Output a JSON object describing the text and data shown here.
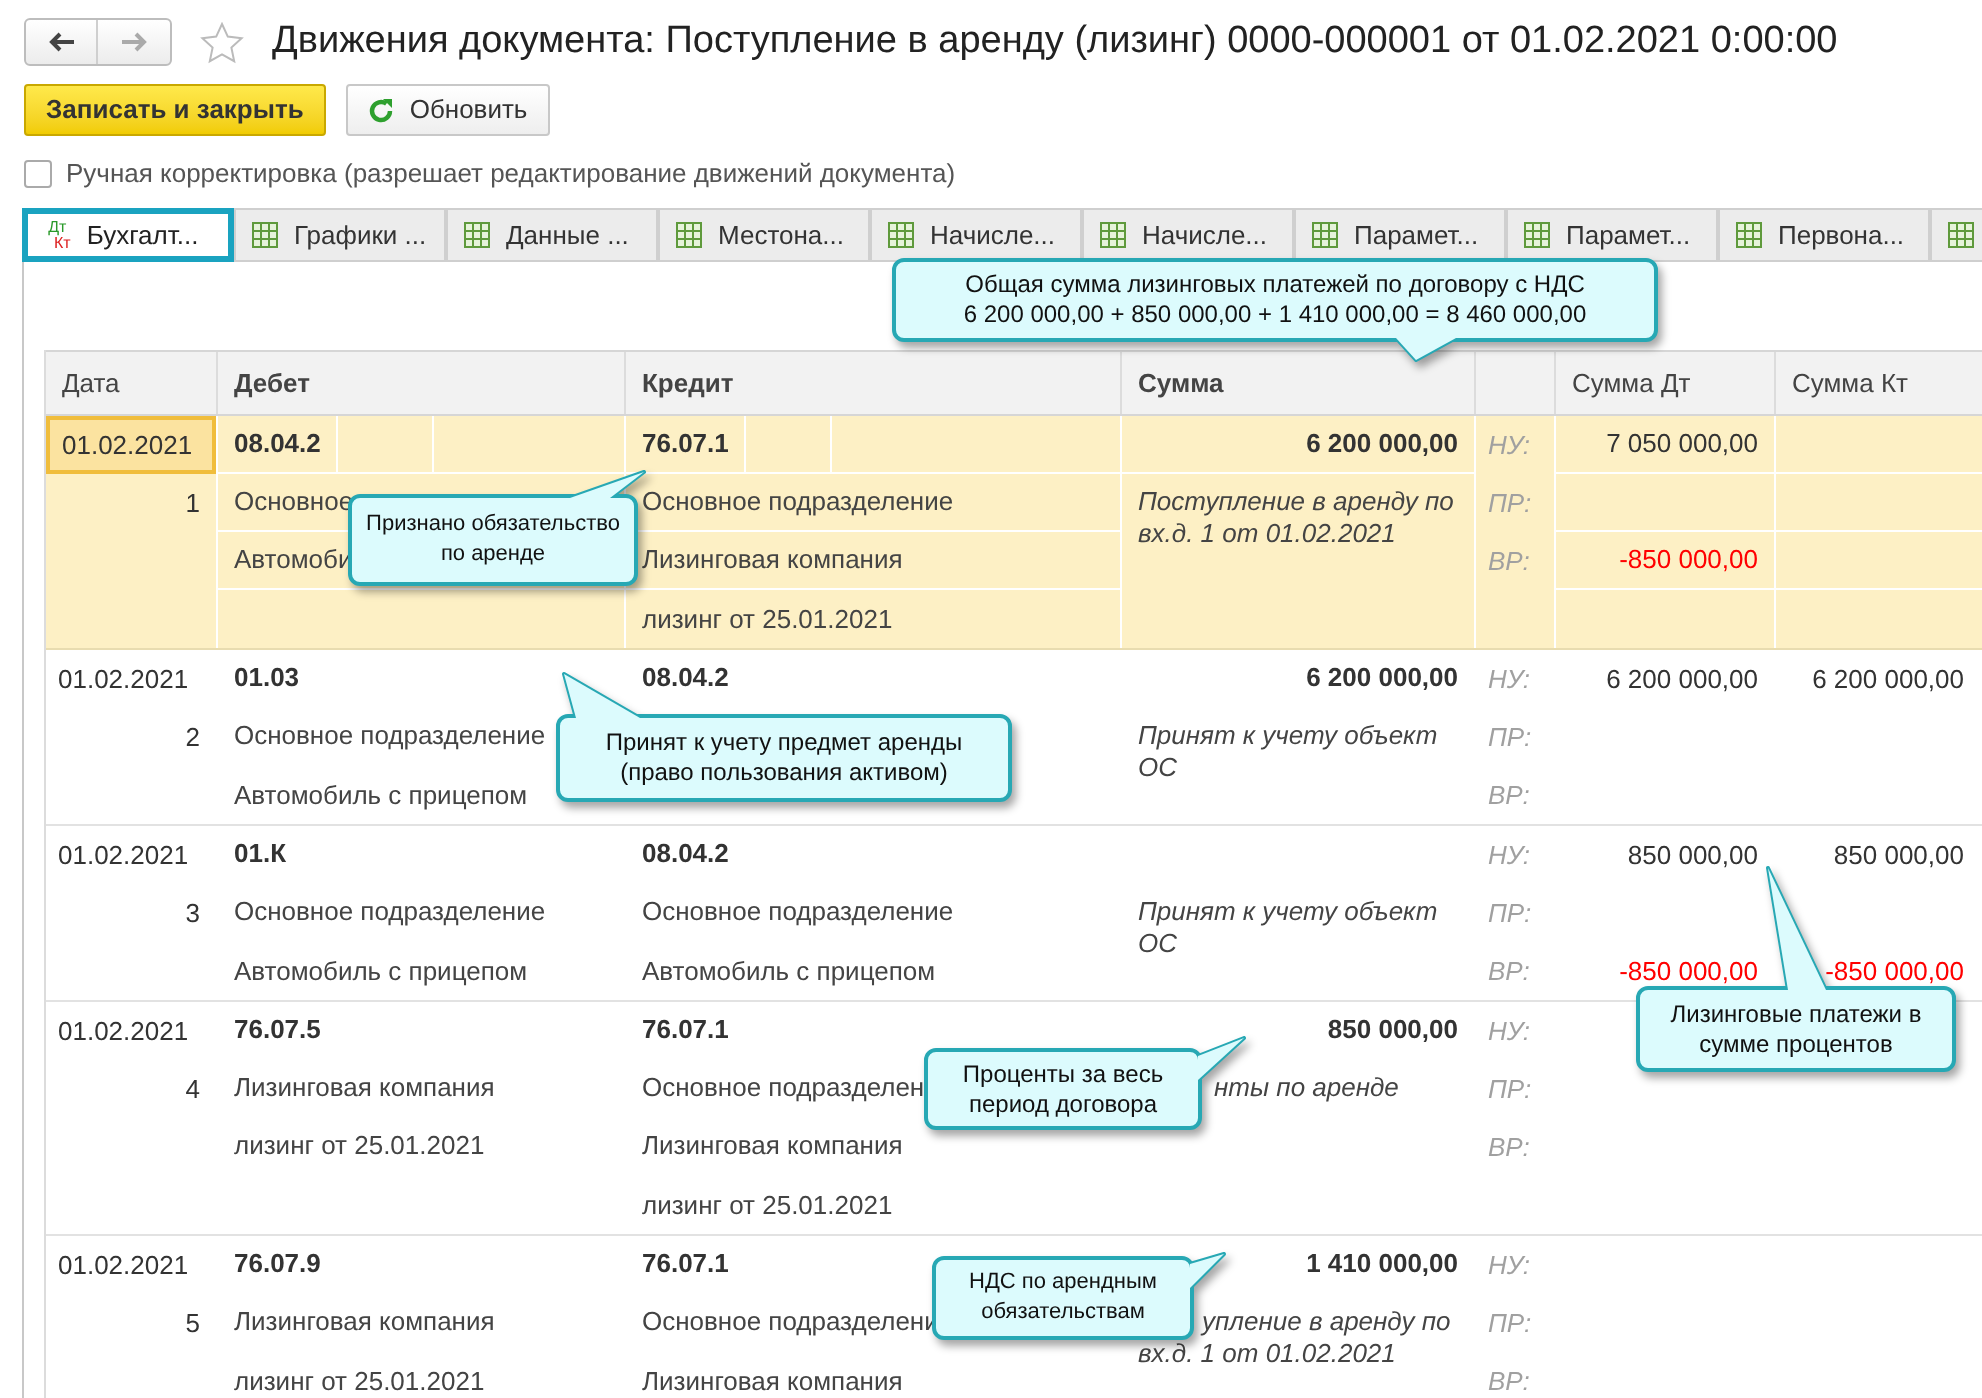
{
  "window": {
    "title": "Движения документа: Поступление в аренду (лизинг) 0000-000001 от 01.02.2021 0:00:00",
    "favorite": false
  },
  "toolbar": {
    "primary_button": "Записать и закрыть",
    "refresh_button": "Обновить"
  },
  "manual_correction": {
    "label": "Ручная корректировка (разрешает редактирование движений документа)",
    "checked": false
  },
  "tabs": [
    {
      "kind": "dtkt",
      "icon_top": "Дт",
      "icon_bottom": "Кт",
      "label": "Бухгалт...",
      "selected": true
    },
    {
      "kind": "table",
      "label": "Графики ...",
      "selected": false
    },
    {
      "kind": "table",
      "label": "Данные ...",
      "selected": false
    },
    {
      "kind": "table",
      "label": "Местона...",
      "selected": false
    },
    {
      "kind": "table",
      "label": "Начисле...",
      "selected": false
    },
    {
      "kind": "table",
      "label": "Начисле...",
      "selected": false
    },
    {
      "kind": "table",
      "label": "Парамет...",
      "selected": false
    },
    {
      "kind": "table",
      "label": "Парамет...",
      "selected": false
    },
    {
      "kind": "table",
      "label": "Первона...",
      "selected": false
    },
    {
      "kind": "table",
      "selected": false
    }
  ],
  "table": {
    "columns": [
      {
        "label": "Дата",
        "bold": false
      },
      {
        "label": "Дебет",
        "bold": true
      },
      {
        "label": "Кредит",
        "bold": true
      },
      {
        "label": "Сумма",
        "bold": true
      },
      {
        "label": "Сумма Дт",
        "bold": false
      },
      {
        "label": "Сумма Кт",
        "bold": false
      }
    ],
    "rows": [
      {
        "selected": true,
        "date": "01.02.2021",
        "number": "1",
        "debit": [
          "08.04.2",
          "Основное",
          "Автомоби"
        ],
        "credit": [
          "76.07.1",
          "Основное подразделение",
          "Лизинговая компания",
          "лизинг от 25.01.2021"
        ],
        "amount": "6 200 000,00",
        "comment": [
          "Поступление в аренду по вх.д. 1 от 01.02.2021"
        ],
        "tax_lines": [
          {
            "label": "НУ:",
            "dt": {
              "text": "7 050 000,00",
              "negative": false
            }
          },
          {
            "label": "ПР:"
          },
          {
            "label": "ВР:",
            "dt": {
              "text": "-850 000,00",
              "negative": true
            }
          }
        ]
      },
      {
        "selected": false,
        "date": "01.02.2021",
        "number": "2",
        "debit": [
          "01.03",
          "Основное подразделение",
          "Автомобиль с прицепом"
        ],
        "credit": [
          "08.04.2"
        ],
        "amount": "6 200 000,00",
        "comment": [
          "Принят к учету объект ОС"
        ],
        "tax_lines": [
          {
            "label": "НУ:",
            "dt": {
              "text": "6 200 000,00",
              "negative": false
            },
            "kt": {
              "text": "6 200 000,00",
              "negative": false
            }
          },
          {
            "label": "ПР:"
          },
          {
            "label": "ВР:"
          }
        ]
      },
      {
        "selected": false,
        "date": "01.02.2021",
        "number": "3",
        "debit": [
          "01.К",
          "Основное подразделение",
          "Автомобиль с прицепом"
        ],
        "credit": [
          "08.04.2",
          "Основное подразделение",
          "Автомобиль с прицепом"
        ],
        "comment": [
          "Принят к учету объект ОС"
        ],
        "tax_lines": [
          {
            "label": "НУ:",
            "dt": {
              "text": "850 000,00",
              "negative": false
            },
            "kt": {
              "text": "850 000,00",
              "negative": false
            }
          },
          {
            "label": "ПР:"
          },
          {
            "label": "ВР:",
            "dt": {
              "text": "-850 000,00",
              "negative": true
            },
            "kt": {
              "text": "-850 000,00",
              "negative": true
            }
          }
        ]
      },
      {
        "selected": false,
        "date": "01.02.2021",
        "number": "4",
        "debit": [
          "76.07.5",
          "Лизинговая компания",
          "лизинг от 25.01.2021"
        ],
        "credit": [
          "76.07.1",
          "Основное подразделен",
          "Лизинговая компания",
          "лизинг от 25.01.2021"
        ],
        "amount": "850 000,00",
        "comment": [
          "нты по аренде"
        ],
        "tax_lines": [
          {
            "label": "НУ:"
          },
          {
            "label": "ПР:"
          },
          {
            "label": "ВР:"
          }
        ]
      },
      {
        "selected": false,
        "date": "01.02.2021",
        "number": "5",
        "debit": [
          "76.07.9",
          "Лизинговая компания",
          "лизинг от 25.01.2021"
        ],
        "credit": [
          "76.07.1",
          "Основное подразделени",
          "Лизинговая компания"
        ],
        "amount": "1 410 000,00",
        "comment": [
          "упление в аренду по",
          "вх.д. 1 от 01.02.2021"
        ],
        "tax_lines": [
          {
            "label": "НУ:"
          },
          {
            "label": "ПР:"
          },
          {
            "label": "ВР:"
          }
        ]
      }
    ]
  },
  "callouts": [
    {
      "text": "Общая сумма лизинговых платежей по договору с НДС 6 200 000,00 + 850 000,00 + 1 410 000,00 = 8 460 000,00"
    },
    {
      "text": "Признано обязательство по аренде"
    },
    {
      "text": "Принят к учету предмет аренды (право пользования активом)"
    },
    {
      "text": "Проценты за весь период договора"
    },
    {
      "text": "НДС по арендным обязательствам"
    },
    {
      "text": "Лизинговые платежи в сумме процентов"
    }
  ]
}
